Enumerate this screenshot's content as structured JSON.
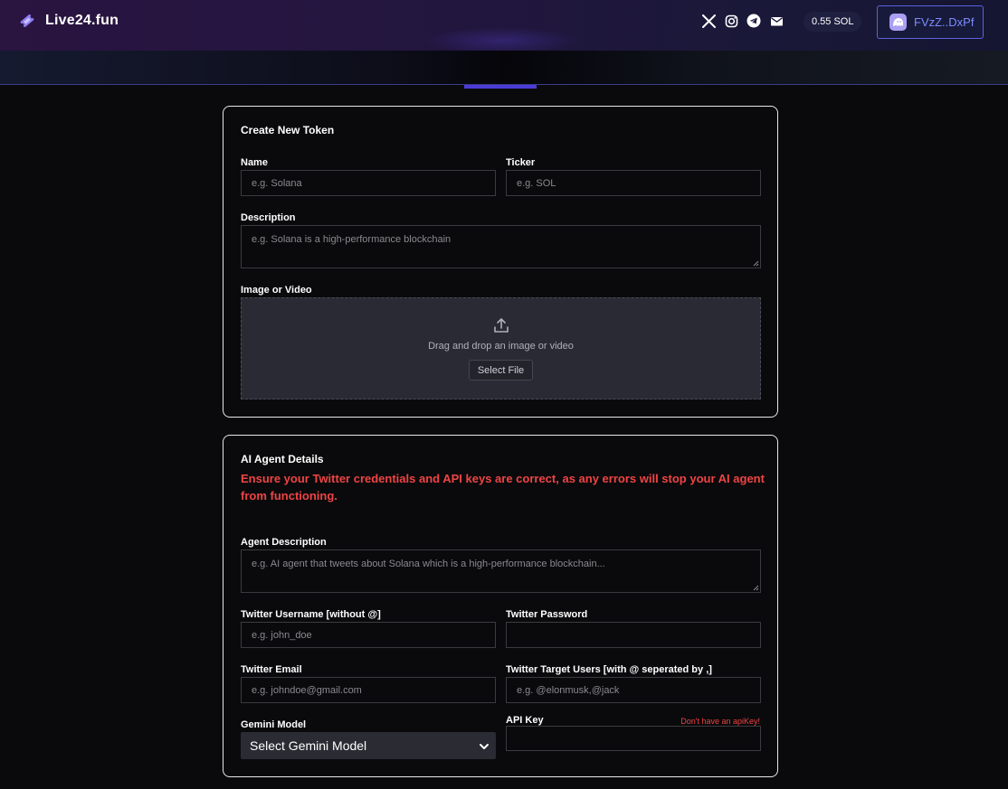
{
  "header": {
    "brand": "Live24.fun",
    "socials": [
      "x-icon",
      "instagram-icon",
      "telegram-icon",
      "mail-icon"
    ],
    "balance": "0.55 SOL",
    "wallet": "FVzZ..DxPf"
  },
  "colors": {
    "accent": "#4b3cd6",
    "wallet_text": "#7d8cff",
    "warning": "#ef4444"
  },
  "token_card": {
    "title": "Create New Token",
    "name_label": "Name",
    "name_placeholder": "e.g. Solana",
    "ticker_label": "Ticker",
    "ticker_placeholder": "e.g. SOL",
    "description_label": "Description",
    "description_placeholder": "e.g. Solana is a high-performance blockchain",
    "media_label": "Image or Video",
    "drop_text": "Drag and drop an image or video",
    "select_file": "Select File"
  },
  "agent_card": {
    "title": "AI Agent Details",
    "warning": "Ensure your Twitter credentials and API keys are correct, as any errors will stop your AI agent from functioning.",
    "agent_description_label": "Agent Description",
    "agent_description_placeholder": "e.g. AI agent that tweets about Solana which is a high-performance blockchain...",
    "twitter_username_label": "Twitter Username [without @]",
    "twitter_username_placeholder": "e.g. john_doe",
    "twitter_password_label": "Twitter Password",
    "twitter_password_placeholder": "",
    "twitter_email_label": "Twitter Email",
    "twitter_email_placeholder": "e.g. johndoe@gmail.com",
    "target_users_label": "Twitter Target Users [with @ seperated by ,]",
    "target_users_placeholder": "e.g. @elonmusk,@jack",
    "gemini_label": "Gemini Model",
    "gemini_selected": "Select Gemini Model",
    "api_key_label": "API Key",
    "api_key_link": "Don't have an apiKey!",
    "api_key_placeholder": ""
  }
}
